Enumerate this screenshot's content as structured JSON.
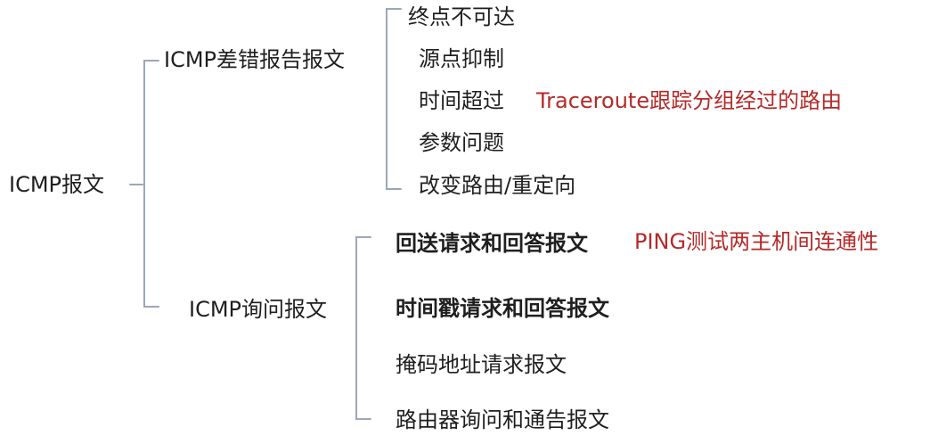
{
  "root": {
    "label": "ICMP报文"
  },
  "error_reports": {
    "label": "ICMP差错报告报文",
    "items": [
      {
        "label": "终点不可达"
      },
      {
        "label": "源点抑制"
      },
      {
        "label": "时间超过",
        "note": "Traceroute跟踪分组经过的路由"
      },
      {
        "label": "参数问题"
      },
      {
        "label": "改变路由/重定向"
      }
    ]
  },
  "query_messages": {
    "label": "ICMP询问报文",
    "items": [
      {
        "label": "回送请求和回答报文",
        "note": "PING测试两主机间连通性"
      },
      {
        "label": "时间戳请求和回答报文"
      },
      {
        "label": "掩码地址请求报文"
      },
      {
        "label": "路由器询问和通告报文"
      }
    ]
  },
  "colors": {
    "text": "#1f1f1f",
    "note": "#b42a28",
    "bracket": "#9aa7b8"
  }
}
